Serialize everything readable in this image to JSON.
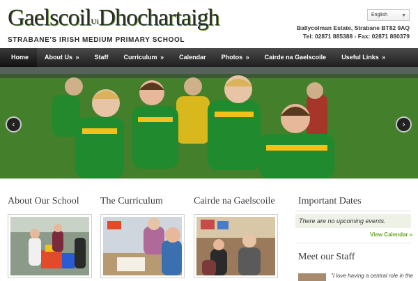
{
  "header": {
    "logo_title_part1": "Gaelscoil",
    "logo_title_small": "Uí",
    "logo_title_part2": "Dhochartaigh",
    "logo_subtitle": "STRABANE'S IRISH MEDIUM PRIMARY SCHOOL",
    "language": "English",
    "address": "Ballycolman Estate, Strabane BT82 9AQ",
    "phone": "Tel: 02871 885388 - Fax: 02871 880379"
  },
  "nav": {
    "items": [
      {
        "label": "Home",
        "dropdown": ""
      },
      {
        "label": "About Us",
        "dropdown": "»"
      },
      {
        "label": "Staff",
        "dropdown": ""
      },
      {
        "label": "Curriculum",
        "dropdown": "»"
      },
      {
        "label": "Calendar",
        "dropdown": ""
      },
      {
        "label": "Photos",
        "dropdown": "»"
      },
      {
        "label": "Cairde na Gaelscoile",
        "dropdown": ""
      },
      {
        "label": "Useful Links",
        "dropdown": "»"
      }
    ]
  },
  "slider": {
    "prev_icon": "‹",
    "next_icon": "›"
  },
  "columns": [
    {
      "title": "About Our School"
    },
    {
      "title": "The Curriculum"
    },
    {
      "title": "Cairde na Gaelscoile"
    }
  ],
  "sidebar": {
    "dates_title": "Important Dates",
    "dates_empty": "There are no upcoming events.",
    "calendar_link": "View Calendar »",
    "staff_title": "Meet our Staff",
    "staff_quote": "\"I love having a central role in the"
  },
  "colors": {
    "nav_bg": "#2a2a2a",
    "accent_green": "#6aa52b",
    "jersey_green": "#1f8a2e",
    "jersey_yellow": "#f2c21a"
  }
}
